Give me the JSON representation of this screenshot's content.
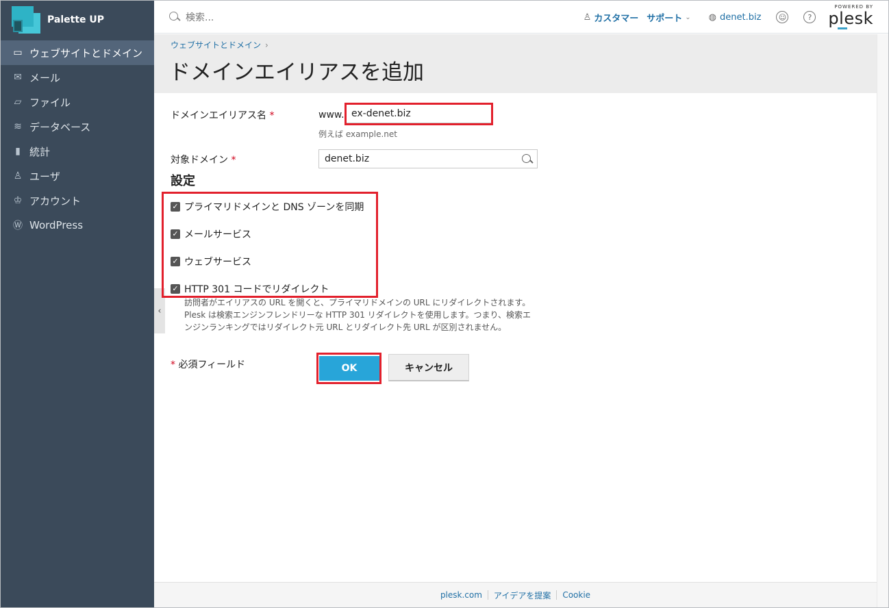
{
  "sidebar": {
    "brand": "Palette UP",
    "items": [
      {
        "label": "ウェブサイトとドメイン",
        "icon": "monitor-icon",
        "glyph": "▭",
        "active": true
      },
      {
        "label": "メール",
        "icon": "mail-icon",
        "glyph": "✉",
        "active": false
      },
      {
        "label": "ファイル",
        "icon": "folder-icon",
        "glyph": "▱",
        "active": false
      },
      {
        "label": "データベース",
        "icon": "database-icon",
        "glyph": "≋",
        "active": false
      },
      {
        "label": "統計",
        "icon": "stats-icon",
        "glyph": "▮",
        "active": false
      },
      {
        "label": "ユーザ",
        "icon": "user-icon",
        "glyph": "♙",
        "active": false
      },
      {
        "label": "アカウント",
        "icon": "account-icon",
        "glyph": "♔",
        "active": false
      },
      {
        "label": "WordPress",
        "icon": "wordpress-icon",
        "glyph": "Ⓦ",
        "active": false
      }
    ]
  },
  "topbar": {
    "search_placeholder": "検索...",
    "customer_label": "カスタマー",
    "support_label": "サポート",
    "domain_label": "denet.biz",
    "powered_by": "POWERED BY",
    "plesk": "plesk"
  },
  "breadcrumb": {
    "item": "ウェブサイトとドメイン"
  },
  "page": {
    "title": "ドメインエイリアスを追加"
  },
  "form": {
    "alias_label": "ドメインエイリアス名",
    "required_mark": "*",
    "www_prefix": "www.",
    "alias_value": "ex-denet.biz",
    "alias_hint": "例えば example.net",
    "target_label": "対象ドメイン",
    "target_value": "denet.biz",
    "settings_title": "設定",
    "checkboxes": [
      {
        "label": "プライマリドメインと DNS ゾーンを同期",
        "checked": true
      },
      {
        "label": "メールサービス",
        "checked": true
      },
      {
        "label": "ウェブサービス",
        "checked": true
      },
      {
        "label": "HTTP 301 コードでリダイレクト",
        "checked": true
      }
    ],
    "redirect_desc": "訪問者がエイリアスの URL を開くと、プライマリドメインの URL にリダイレクトされます。Plesk は検索エンジンフレンドリーな HTTP 301 リダイレクトを使用します。つまり、検索エンジンランキングではリダイレクト元 URL とリダイレクト先 URL が区別されません。",
    "required_note": "必須フィールド",
    "ok_label": "OK",
    "cancel_label": "キャンセル"
  },
  "footer": {
    "links": [
      "plesk.com",
      "アイデアを提案",
      "Cookie"
    ]
  },
  "colors": {
    "sidebar_bg": "#3b4a5a",
    "accent": "#28a5d9",
    "highlight": "#e2202c",
    "link": "#1f6fa5"
  }
}
